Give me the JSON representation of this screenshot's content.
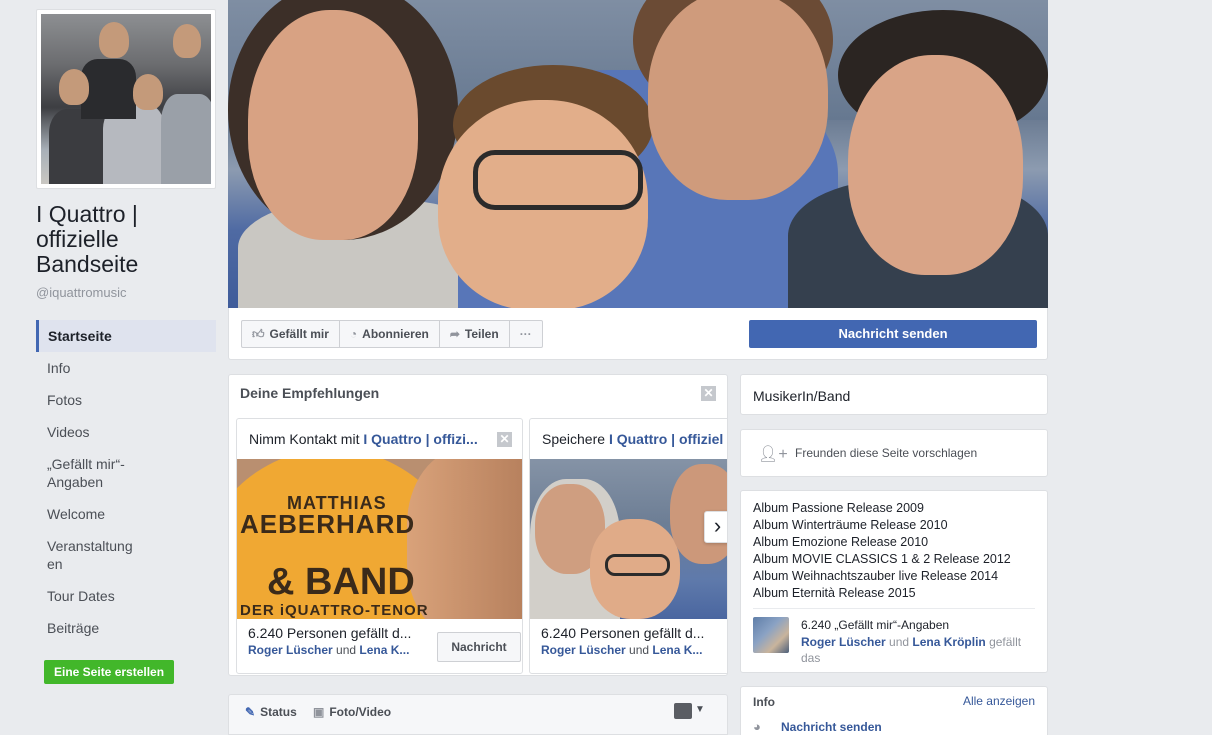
{
  "page": {
    "name": "I Quattro | offizielle Bandseite",
    "handle": "@iquattromusic"
  },
  "nav": {
    "items": [
      {
        "label": "Startseite",
        "active": true
      },
      {
        "label": "Info"
      },
      {
        "label": "Fotos"
      },
      {
        "label": "Videos"
      },
      {
        "label": "„Gefällt mir“-Angaben"
      },
      {
        "label": "Welcome"
      },
      {
        "label": "Veranstaltungen"
      },
      {
        "label": "Tour Dates"
      },
      {
        "label": "Beiträge"
      }
    ],
    "create_page": "Eine Seite erstellen"
  },
  "actions": {
    "like": "Gefällt mir",
    "follow": "Abonnieren",
    "share": "Teilen",
    "more": "···",
    "send_message": "Nachricht senden"
  },
  "recommendations": {
    "title": "Deine Empfehlungen",
    "cards": [
      {
        "prefix": "Nimm Kontakt mit ",
        "page": "I Quattro | offizi...",
        "poster": {
          "line1": "MATTHIAS",
          "line2": "AEBERHARD",
          "line3": "& BAND",
          "line4": "DER iQUATTRO-TENOR"
        },
        "count": "6.240 Personen gefällt d...",
        "friend1": "Roger Lüscher",
        "and": " und ",
        "friend2": "Lena K...",
        "button": "Nachricht"
      },
      {
        "prefix": "Speichere ",
        "page": "I Quattro | offiziel",
        "count": "6.240 Personen gefällt d...",
        "friend1": "Roger Lüscher",
        "and": " und ",
        "friend2": "Lena K..."
      }
    ]
  },
  "composer": {
    "status": "Status",
    "photo": "Foto/Video"
  },
  "sidebar": {
    "category": "MusikerIn/Band",
    "suggest": "Freunden diese Seite vorschlagen",
    "albums": [
      "Album Passione Release 2009",
      "Album Winterträume Release 2010",
      "Album Emozione Release 2010",
      "Album MOVIE CLASSICS 1 & 2 Release 2012",
      "Album Weihnachtszauber live Release 2014",
      "Album Eternità Release 2015"
    ],
    "likes_count": "6.240 „Gefällt mir“-Angaben",
    "likes_friend1": "Roger Lüscher",
    "likes_and": " und ",
    "likes_friend2": "Lena Kröplin",
    "likes_suffix": " gefällt das",
    "info_title": "Info",
    "info_show_all": "Alle anzeigen",
    "info_message": "Nachricht senden"
  },
  "colors": {
    "brand": "#4267b2",
    "link": "#365899",
    "create_button": "#42b72a",
    "background": "#e9ebee"
  }
}
